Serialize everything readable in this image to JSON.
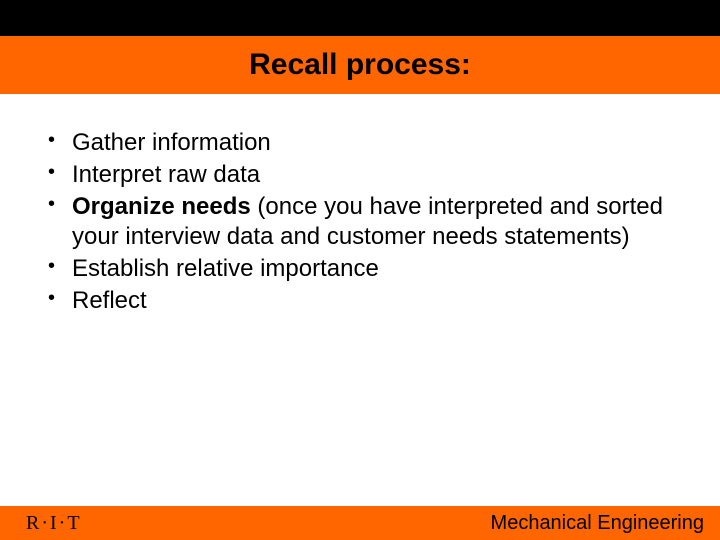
{
  "title": "Recall process:",
  "bullets": {
    "b1": "Gather information",
    "b2": "Interpret raw data",
    "b3_bold": "Organize needs",
    "b3_rest": " (once you have interpreted and sorted your interview data and customer needs statements)",
    "b4": "Establish relative importance",
    "b5": "Reflect"
  },
  "footer": {
    "left": "R·I·T",
    "right": "Mechanical Engineering"
  }
}
